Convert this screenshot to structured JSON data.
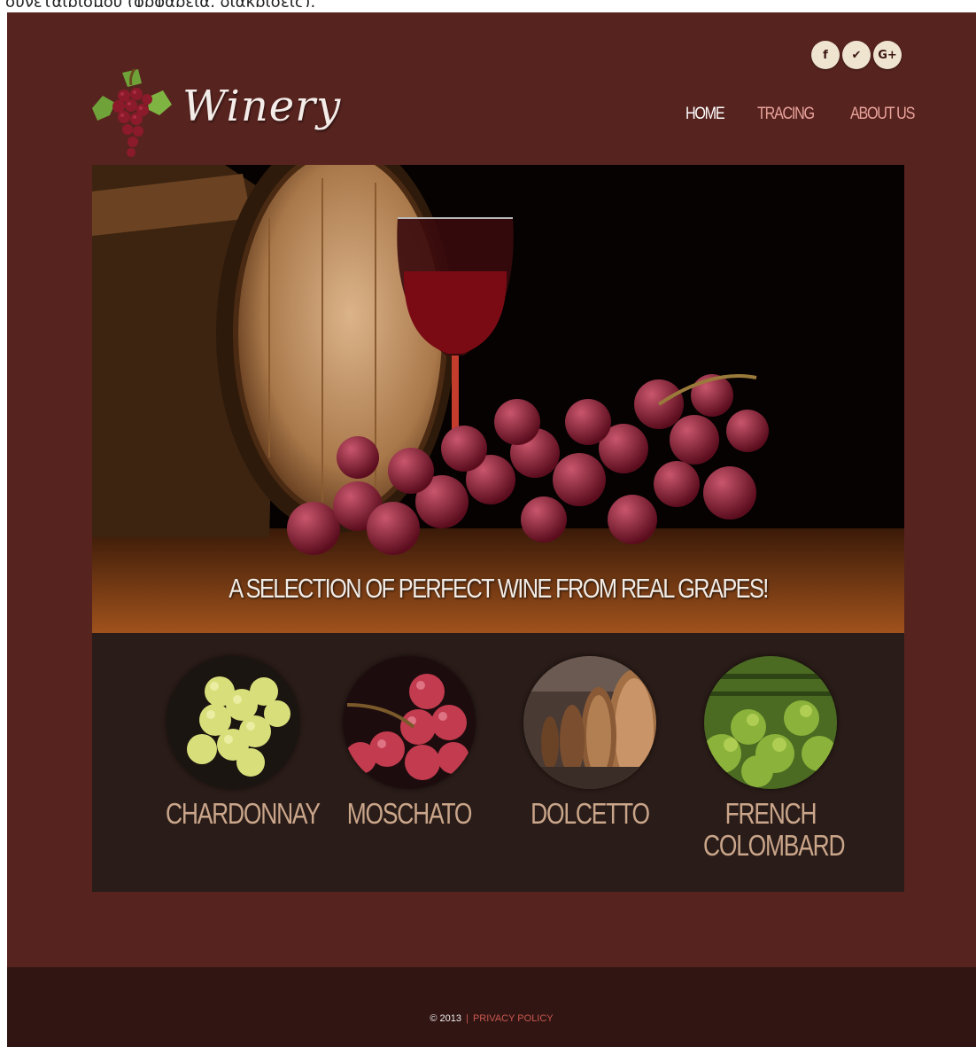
{
  "top_strip": {
    "text": "συνεταιρισμού (φρφαρεία, διακρίσεις)."
  },
  "social": [
    {
      "label": "f",
      "icon": "facebook-icon"
    },
    {
      "label": "✔",
      "icon": "twitter-icon"
    },
    {
      "label": "G+",
      "icon": "google-plus-icon"
    }
  ],
  "logo": {
    "text": "Winery"
  },
  "nav": {
    "home": "HOME",
    "tracing": "TRACING",
    "about": "ABOUT US"
  },
  "hero": {
    "caption": "A SELECTION OF PERFECT WINE FROM REAL GRAPES!"
  },
  "varieties": [
    {
      "name": "CHARDONNAY"
    },
    {
      "name": "MOSCHATO"
    },
    {
      "name": "DOLCETTO"
    },
    {
      "name": "FRENCH COLOMBARD"
    }
  ],
  "footer": {
    "copyright": "© 2013",
    "separator": "|",
    "privacy": "PRIVACY POLICY"
  },
  "colors": {
    "page_bg": "#57231f",
    "panel_bg": "#2a1c18",
    "footer_bg": "#311513",
    "nav_link": "#e8a39b",
    "variety_text": "#c9a58a",
    "footer_link": "#c9584f"
  }
}
